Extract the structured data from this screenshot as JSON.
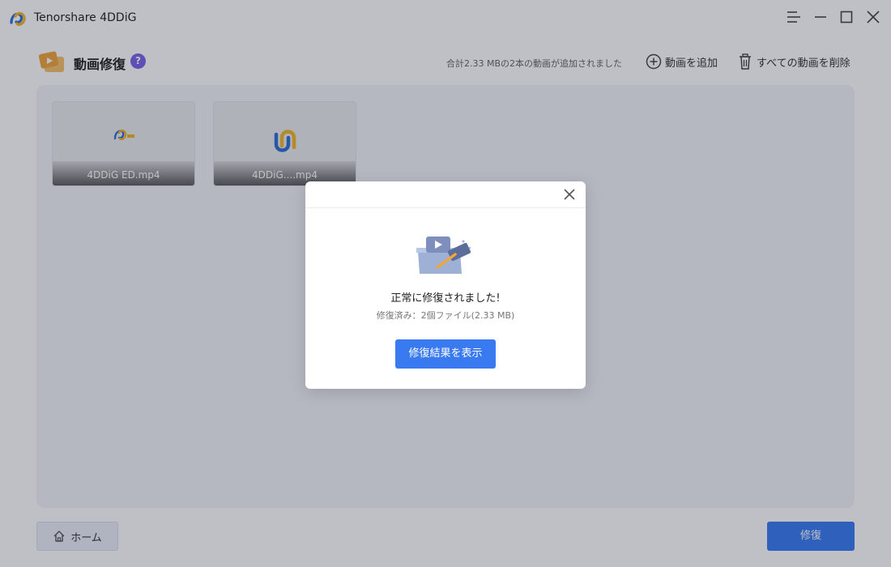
{
  "window": {
    "title": "Tenorshare 4DDiG",
    "menu_icon": "menu-icon",
    "minimize_icon": "minimize-icon",
    "maximize_icon": "maximize-icon",
    "close_icon": "close-icon"
  },
  "header": {
    "title": "動画修復",
    "help": "?",
    "summary": "合計2.33 MBの2本の動画が追加されました",
    "add_label": "動画を追加",
    "delete_label": "すべての動画を削除"
  },
  "videos": [
    {
      "name": "4DDiG ED.mp4"
    },
    {
      "name": "4DDiG....mp4"
    }
  ],
  "footer": {
    "home_label": "ホーム",
    "repair_label": "修復"
  },
  "dialog": {
    "message": "正常に修復されました!",
    "detail": "修復済み：2個ファイル(2.33 MB)",
    "button_label": "修復結果を表示"
  },
  "colors": {
    "accent": "#3a7af0",
    "help_badge": "#7b61e8",
    "panel_bg": "#f3f4f8",
    "overlay": "rgba(20,30,50,0.28)"
  }
}
